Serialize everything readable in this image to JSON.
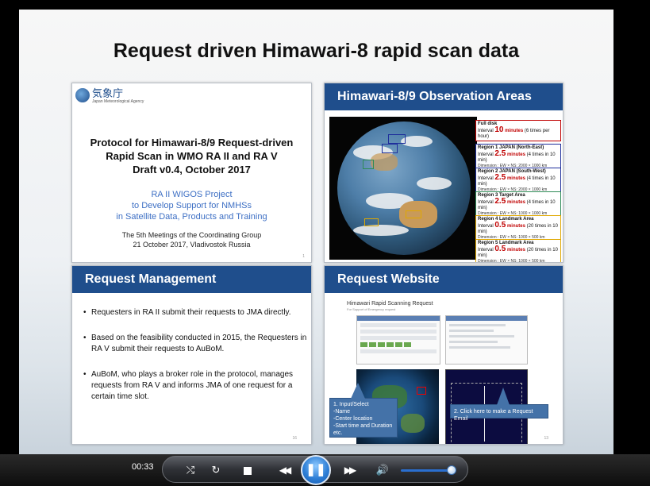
{
  "slide": {
    "title": "Request driven Himawari-8 rapid scan data"
  },
  "panel_protocol": {
    "logo_text": "気象庁",
    "logo_sub": "Japan Meteorological Agency",
    "title_line1": "Protocol for Himawari-8/9 Request-driven",
    "title_line2": "Rapid Scan in WMO RA II and RA V",
    "title_line3": "Draft v0.4, October 2017",
    "project_line1": "RA II WIGOS Project",
    "project_line2": "to Develop Support for NMHSs",
    "project_line3": "in Satellite Data, Products and Training",
    "meeting_line1": "The 5th Meetings of the Coordinating Group",
    "meeting_line2": "21 October 2017, Vladivostok Russia",
    "page_number": "1"
  },
  "panel_observation": {
    "header": "Himawari-8/9 Observation Areas",
    "areas": [
      {
        "name": "Full disk",
        "interval_label": "Interval",
        "value": "10",
        "unit": "minutes",
        "detail": "(6 times per hour)",
        "dimension": "",
        "color": "#c00000"
      },
      {
        "name": "Region 1 JAPAN (North-East)",
        "interval_label": "Interval",
        "value": "2.5",
        "unit": "minutes",
        "detail": "(4 times in 10 min)",
        "dimension": "Dimension : EW × NS: 2000 × 1000 km",
        "color": "#1f2f9c"
      },
      {
        "name": "Region 2 JAPAN (South-West)",
        "interval_label": "Interval",
        "value": "2.5",
        "unit": "minutes",
        "detail": "(4 times in 10 min)",
        "dimension": "Dimension : EW × NS: 2000 × 1000 km",
        "color": "#1f2f9c"
      },
      {
        "name": "Region 3 Target Area",
        "interval_label": "Interval",
        "value": "2.5",
        "unit": "minutes",
        "detail": "(4 times in 10 min)",
        "dimension": "Dimension : EW × NS: 1000 × 1000 km",
        "color": "#2e8b57"
      },
      {
        "name": "Region 4 Landmark Area",
        "interval_label": "Interval",
        "value": "0.5",
        "unit": "minutes",
        "detail": "(20 times in 10 min)",
        "dimension": "Dimension : EW × NS: 1000 × 500 km",
        "color": "#e0a800"
      },
      {
        "name": "Region 5 Landmark Area",
        "interval_label": "Interval",
        "value": "0.5",
        "unit": "minutes",
        "detail": "(20 times in 10 min)",
        "dimension": "Dimension : EW × NS: 1000 × 500 km",
        "color": "#e0a800"
      }
    ]
  },
  "panel_management": {
    "header": "Request Management",
    "bullets": [
      "Requesters in RA II submit their requests to JMA directly.",
      "Based on the feasibility conducted in 2015, the Requesters in RA V submit their requests to AuBoM.",
      "AuBoM, who plays a broker role in the protocol, manages requests from RA V and informs JMA of one request for a certain time slot."
    ],
    "page_number": "16"
  },
  "panel_website": {
    "header": "Request Website",
    "site_title": "Himawari Rapid Scanning Request",
    "site_sub": "For Support of Emergency request",
    "callout_left": [
      "1. Input/Select",
      "-Name",
      "-Center location",
      "-Start time and Duration",
      "etc."
    ],
    "callout_right": "2. Click here to make a Request Email",
    "page_number": "13"
  },
  "player": {
    "time": "00:33",
    "icons": {
      "shuffle": "shuffle-icon",
      "repeat": "repeat-icon",
      "stop": "stop-icon",
      "prev": "rewind-icon",
      "play": "pause-icon",
      "next": "fast-forward-icon",
      "volume": "volume-icon"
    },
    "accent": "#2e7fd6"
  }
}
